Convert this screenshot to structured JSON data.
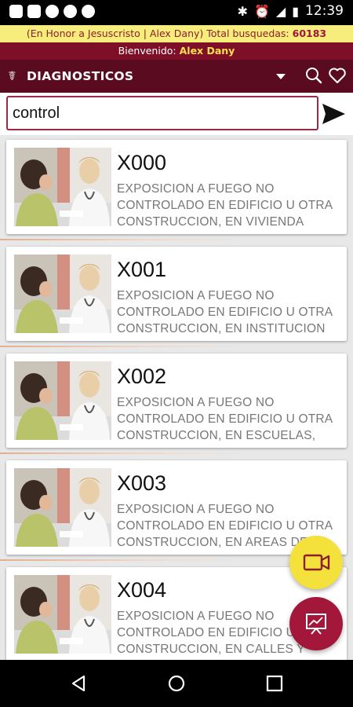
{
  "status": {
    "time": "12:39"
  },
  "honor_bar": {
    "text": "(En Honor a Jesuscristo | Alex Dany)  Total busquedas:",
    "count": "60183"
  },
  "welcome_bar": {
    "greeting": "Bienvenido:",
    "user": "Alex Dany"
  },
  "toolbar": {
    "title": "DIAGNOSTICOS"
  },
  "search": {
    "value": "control"
  },
  "results": [
    {
      "code": "X000",
      "description": "EXPOSICION A FUEGO NO CONTROLADO EN EDIFICIO U OTRA CONSTRUCCION, EN VIVIENDA"
    },
    {
      "code": "X001",
      "description": "EXPOSICION A FUEGO NO CONTROLADO EN EDIFICIO U OTRA CONSTRUCCION, EN INSTITUCION"
    },
    {
      "code": "X002",
      "description": "EXPOSICION A FUEGO NO CONTROLADO EN EDIFICIO U OTRA CONSTRUCCION, EN ESCUELAS,"
    },
    {
      "code": "X003",
      "description": "EXPOSICION A FUEGO NO CONTROLADO EN EDIFICIO U OTRA CONSTRUCCION, EN AREAS DE"
    },
    {
      "code": "X004",
      "description": "EXPOSICION A FUEGO NO CONTROLADO EN EDIFICIO U OTRA CONSTRUCCION, EN CALLES Y"
    }
  ],
  "icons": {
    "toolbar": [
      "stethoscope-icon",
      "chevron-down-icon",
      "search-icon",
      "heart-icon"
    ],
    "search": [
      "send-icon"
    ],
    "fabs": [
      "video-camera-icon",
      "presentation-icon"
    ],
    "nav": [
      "back-icon",
      "home-icon",
      "recent-apps-icon"
    ]
  },
  "colors": {
    "honor_bg": "#f7ed7c",
    "welcome_bg": "#7d1028",
    "toolbar_bg": "#5a0b1f",
    "fab_video": "#f5e13c",
    "fab_present": "#a3173a",
    "accent_username": "#ffe14a"
  }
}
